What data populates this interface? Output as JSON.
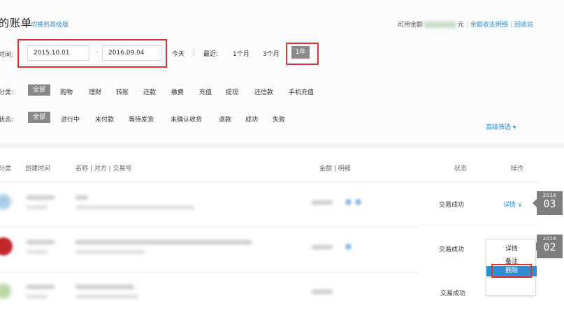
{
  "header": {
    "title": "的账单",
    "switch_link": "切换到高级版",
    "balance_prefix": "可用余额",
    "balance_unit": "元",
    "balance_links": [
      "余额收支明细",
      "回收站"
    ]
  },
  "time_filter": {
    "label": "时间:",
    "start_date": "2015.10.01",
    "dash": "-",
    "end_date": "2016.09.04",
    "today": "今天",
    "recent_label": "最近:",
    "options": [
      "1个月",
      "3个月"
    ],
    "selected": "1年"
  },
  "category_filter": {
    "label": "分类:",
    "selected": "全部",
    "options": [
      "购物",
      "理财",
      "转账",
      "还款",
      "缴费",
      "充值",
      "提现",
      "还信款",
      "手机充值"
    ]
  },
  "status_filter": {
    "label": "状态:",
    "selected": "全部",
    "options": [
      "进行中",
      "未付款",
      "等待发货",
      "未确认收货",
      "退款",
      "成功",
      "失败"
    ],
    "advanced": "高级筛选 ▾"
  },
  "table": {
    "headers": {
      "category": "分类",
      "created": "创建时间",
      "name_party_no": "名称 | 对方 | 交易号",
      "amount_detail": "金额 | 明细",
      "status": "状态",
      "action": "操作"
    },
    "rows": [
      {
        "status": "交易成功",
        "action": "详情 ∨",
        "badge_year": "2016",
        "badge_month": "03"
      },
      {
        "status": "交易成功",
        "badge_year": "2016",
        "badge_month": "02"
      },
      {
        "status": "交易成功"
      }
    ]
  },
  "context_menu": {
    "items": [
      "详情",
      "备注",
      "删除"
    ],
    "active": "删除"
  },
  "colors": {
    "link": "#2b8fd6",
    "highlight_frame": "#d73535",
    "selected_chip": "#888888",
    "menu_active": "#2e8ed3"
  }
}
